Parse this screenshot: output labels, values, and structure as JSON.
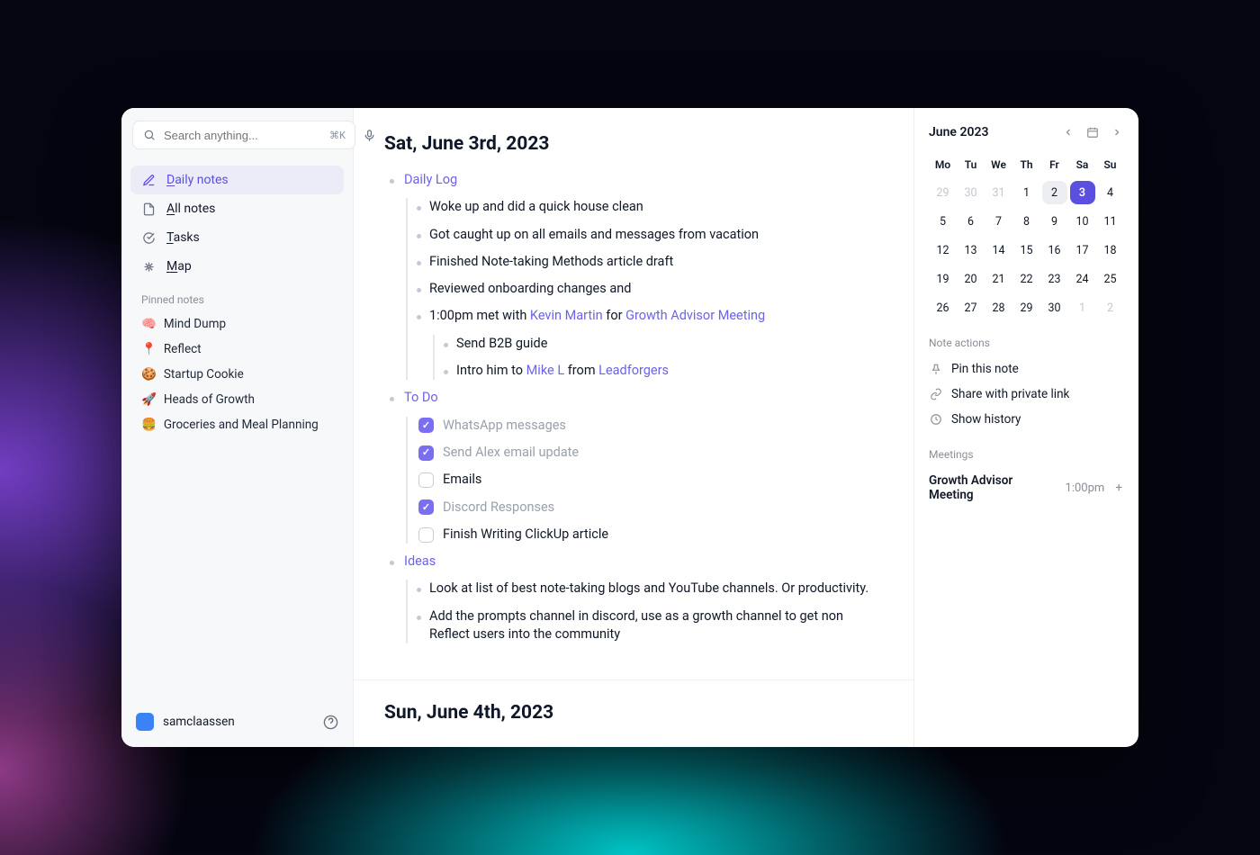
{
  "search": {
    "placeholder": "Search anything...",
    "shortcut": "⌘K"
  },
  "nav": {
    "daily": "Daily notes",
    "all": "All notes",
    "tasks": "Tasks",
    "map": "Map"
  },
  "pinned_label": "Pinned notes",
  "pinned": [
    {
      "emoji": "🧠",
      "label": "Mind Dump"
    },
    {
      "emoji": "📍",
      "label": "Reflect"
    },
    {
      "emoji": "🍪",
      "label": "Startup Cookie"
    },
    {
      "emoji": "🚀",
      "label": "Heads of Growth"
    },
    {
      "emoji": "🍔",
      "label": "Groceries and Meal Planning"
    }
  ],
  "user": "samclaassen",
  "note": {
    "title": "Sat, June 3rd, 2023",
    "sections": {
      "daily_log": "Daily Log",
      "todo": "To Do",
      "ideas": "Ideas"
    },
    "daily_log_items": [
      "Woke up and did a quick house clean",
      "Got caught up on all emails and messages from vacation",
      "Finished Note-taking Methods article draft",
      "Reviewed onboarding changes and"
    ],
    "meeting_line": {
      "prefix": "1:00pm met with ",
      "person": "Kevin Martin",
      "mid": " for ",
      "event": "Growth Advisor Meeting"
    },
    "meeting_sub": {
      "a": "Send B2B guide",
      "b_pre": "Intro him to ",
      "b_link1": "Mike L",
      "b_mid": " from ",
      "b_link2": "Leadforgers"
    },
    "todos": [
      {
        "done": true,
        "text": "WhatsApp messages"
      },
      {
        "done": true,
        "text": "Send Alex email update"
      },
      {
        "done": false,
        "text": "Emails"
      },
      {
        "done": true,
        "text": "Discord Responses"
      },
      {
        "done": false,
        "text": "Finish Writing ClickUp article"
      }
    ],
    "ideas": [
      "Look at list of best note-taking blogs and YouTube channels. Or productivity.",
      "Add the prompts channel in discord, use as a growth channel to get non Reflect users into the community"
    ],
    "next_title": "Sun, June 4th, 2023"
  },
  "calendar": {
    "title": "June 2023",
    "dow": [
      "Mo",
      "Tu",
      "We",
      "Th",
      "Fr",
      "Sa",
      "Su"
    ],
    "weeks": [
      [
        {
          "n": 29,
          "out": true
        },
        {
          "n": 30,
          "out": true
        },
        {
          "n": 31,
          "out": true
        },
        {
          "n": 1
        },
        {
          "n": 2,
          "hl": true
        },
        {
          "n": 3,
          "sel": true
        },
        {
          "n": 4
        }
      ],
      [
        {
          "n": 5
        },
        {
          "n": 6
        },
        {
          "n": 7
        },
        {
          "n": 8
        },
        {
          "n": 9
        },
        {
          "n": 10
        },
        {
          "n": 11
        }
      ],
      [
        {
          "n": 12
        },
        {
          "n": 13
        },
        {
          "n": 14
        },
        {
          "n": 15
        },
        {
          "n": 16
        },
        {
          "n": 17
        },
        {
          "n": 18
        }
      ],
      [
        {
          "n": 19
        },
        {
          "n": 20
        },
        {
          "n": 21
        },
        {
          "n": 22
        },
        {
          "n": 23
        },
        {
          "n": 24
        },
        {
          "n": 25
        }
      ],
      [
        {
          "n": 26
        },
        {
          "n": 27
        },
        {
          "n": 28
        },
        {
          "n": 29
        },
        {
          "n": 30
        },
        {
          "n": 1,
          "out": true
        },
        {
          "n": 2,
          "out": true
        }
      ]
    ]
  },
  "rpanel": {
    "note_actions_label": "Note actions",
    "pin": "Pin this note",
    "share": "Share with private link",
    "history": "Show history",
    "meetings_label": "Meetings",
    "meeting": {
      "name": "Growth Advisor Meeting",
      "time": "1:00pm"
    }
  }
}
